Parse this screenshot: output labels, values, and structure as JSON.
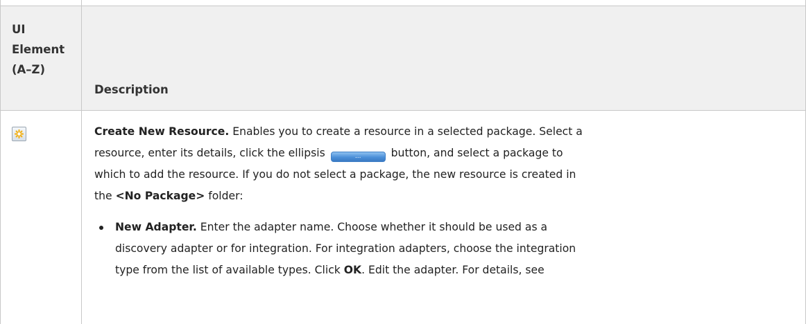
{
  "table": {
    "header": {
      "col1_lines": [
        "UI",
        "Element",
        "(A–Z)"
      ],
      "col2": "Description"
    },
    "row1": {
      "icon": "new-resource-star-icon",
      "title": "Create New Resource.",
      "text_lines": [
        " Enables you to create a resource in a selected package. Select a",
        "resource, enter its details, click the ellipsis",
        " button, and select a package to",
        "which to add the resource. If you do not select a package, the new resource is created in",
        "the ",
        " folder:"
      ],
      "ellipsis_button_label": "...",
      "no_package": "<No Package>",
      "bullet": {
        "title": "New Adapter.",
        "line1": " Enter the adapter name. Choose whether it should be used as a",
        "line2": "discovery adapter or for integration. For integration adapters, choose the integration",
        "line3a": "type from the list of available types. Click ",
        "ok": "OK",
        "line3b": ". Edit the adapter. For details, see"
      }
    }
  },
  "colors": {
    "border": "#c8c8c8",
    "header_background": "#f0f0f0",
    "button_blue": "#4b8fd8",
    "icon_star": "#f2b21b"
  }
}
